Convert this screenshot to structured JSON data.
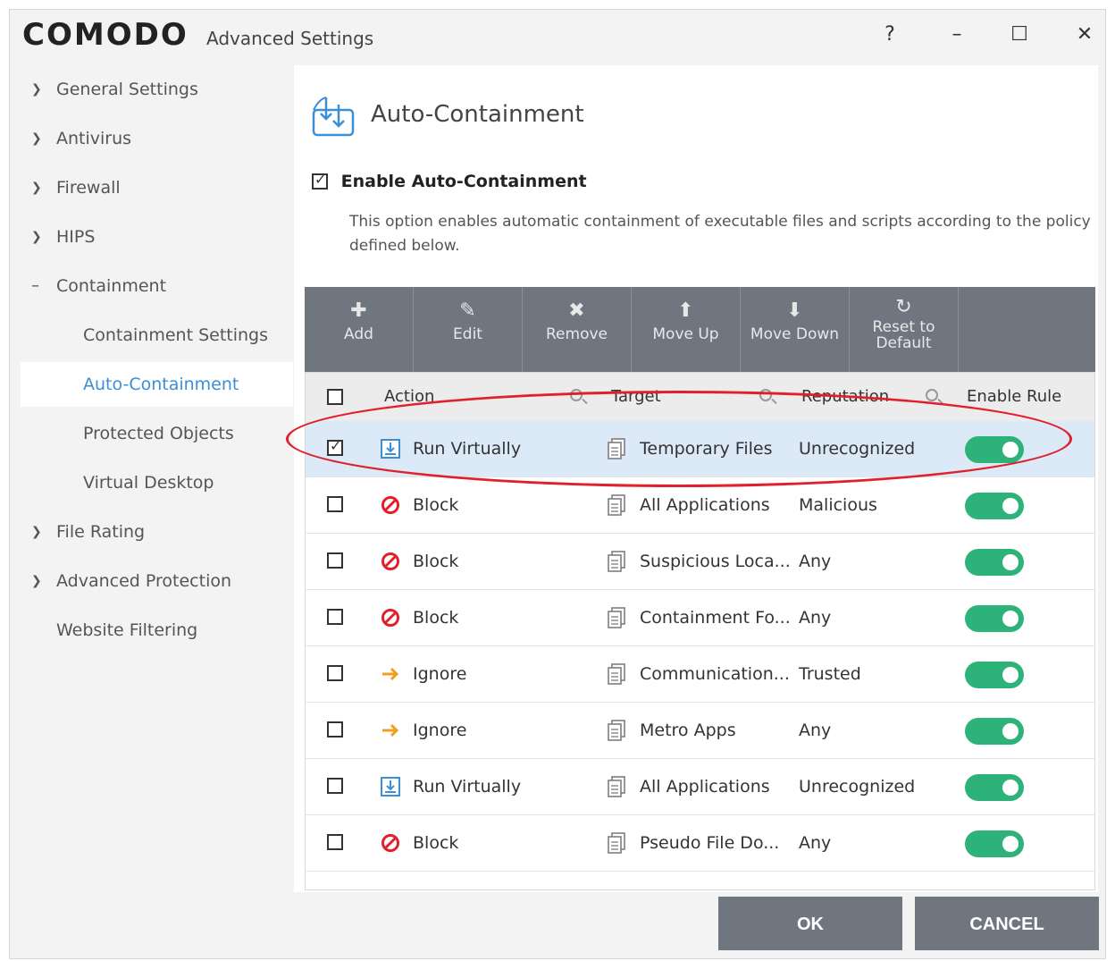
{
  "window": {
    "logo": "COMODO",
    "title": "Advanced Settings",
    "help": "?",
    "minimize": "–",
    "maximize": "☐",
    "close": "✕"
  },
  "sidebar": {
    "items": [
      {
        "label": "General Settings"
      },
      {
        "label": "Antivirus"
      },
      {
        "label": "Firewall"
      },
      {
        "label": "HIPS"
      },
      {
        "label": "Containment"
      },
      {
        "label": "Containment Settings"
      },
      {
        "label": "Auto-Containment"
      },
      {
        "label": "Protected Objects"
      },
      {
        "label": "Virtual Desktop"
      },
      {
        "label": "File Rating"
      },
      {
        "label": "Advanced Protection"
      },
      {
        "label": "Website Filtering"
      }
    ]
  },
  "main": {
    "title": "Auto-Containment",
    "enable_label": "Enable Auto-Containment",
    "description": "This option enables automatic containment of executable files and scripts according to the policy defined below."
  },
  "toolbar": {
    "add": "Add",
    "edit": "Edit",
    "remove": "Remove",
    "move_up": "Move Up",
    "move_down": "Move Down",
    "reset_line1": "Reset to",
    "reset_line2": "Default"
  },
  "table": {
    "headers": {
      "action": "Action",
      "target": "Target",
      "reputation": "Reputation",
      "enable_rule": "Enable Rule"
    },
    "rows": [
      {
        "action": "Run Virtually",
        "target": "Temporary Files",
        "reputation": "Unrecognized"
      },
      {
        "action": "Block",
        "target": "All Applications",
        "reputation": "Malicious"
      },
      {
        "action": "Block",
        "target": "Suspicious Loca...",
        "reputation": "Any"
      },
      {
        "action": "Block",
        "target": "Containment Fo...",
        "reputation": "Any"
      },
      {
        "action": "Ignore",
        "target": "Communication...",
        "reputation": "Trusted"
      },
      {
        "action": "Ignore",
        "target": "Metro Apps",
        "reputation": "Any"
      },
      {
        "action": "Run Virtually",
        "target": "All Applications",
        "reputation": "Unrecognized"
      },
      {
        "action": "Block",
        "target": "Pseudo File Do...",
        "reputation": "Any"
      }
    ]
  },
  "footer": {
    "ok": "OK",
    "cancel": "CANCEL"
  },
  "colors": {
    "accent": "#3b8fd6",
    "toggle_on": "#2db37a",
    "toolbar": "#6f7680",
    "block": "#e0202a",
    "ignore": "#f0a020",
    "highlight": "#e0202a"
  }
}
